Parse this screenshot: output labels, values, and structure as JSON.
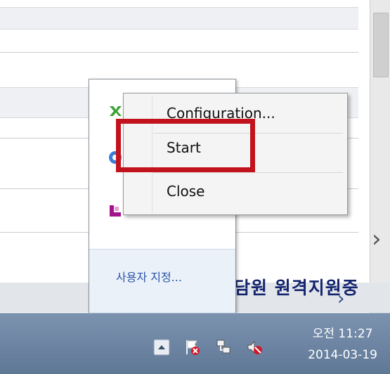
{
  "context_menu": {
    "items": [
      {
        "label": "Configuration..."
      },
      {
        "label": "Start"
      },
      {
        "label": "Close"
      }
    ]
  },
  "tray_popup": {
    "customize_link": "사용자 지정..."
  },
  "background": {
    "partial_text": "담원 원격지원중"
  },
  "taskbar": {
    "clock_time": "오전 11:27",
    "clock_date": "2014-03-19"
  },
  "icons": {
    "show_hidden": "chevron-up-icon",
    "action_center": "flag-warning-icon",
    "network": "network-icon",
    "volume": "volume-muted-icon"
  },
  "colors": {
    "highlight": "#c2121c",
    "taskbar": "#6a83a2",
    "link": "#2a53a8"
  }
}
